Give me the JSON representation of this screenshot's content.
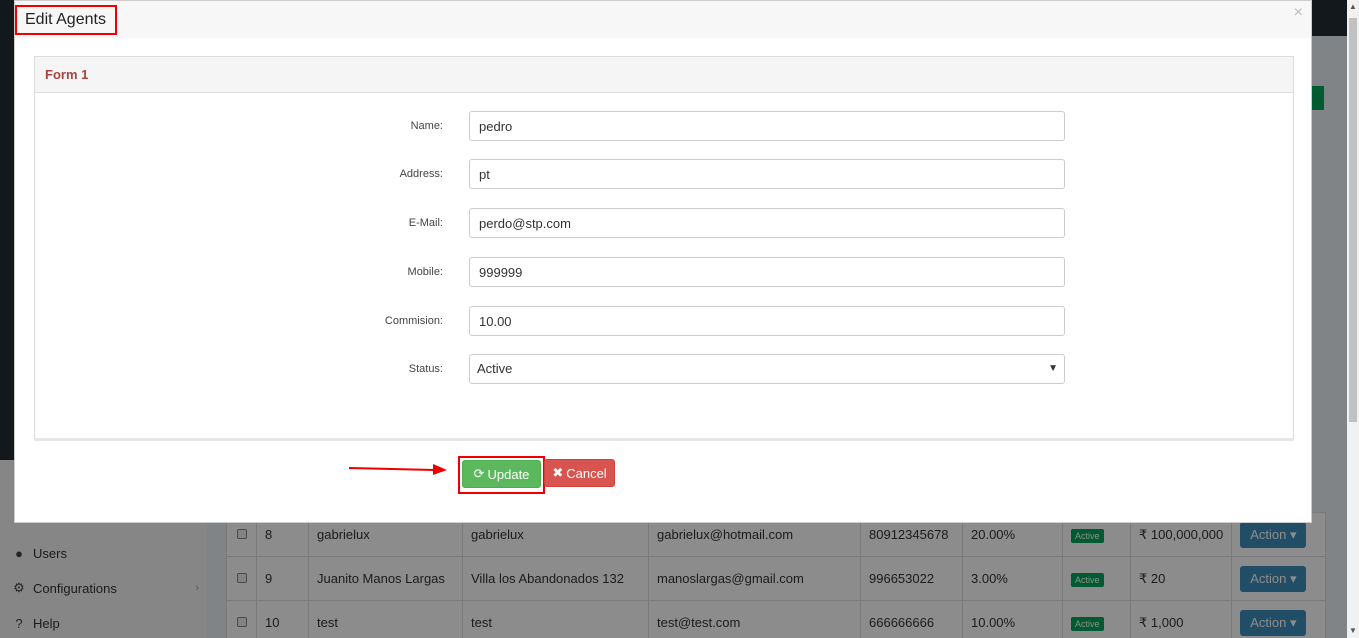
{
  "modal": {
    "title": "Edit Agents",
    "close_glyph": "×",
    "panel_title": "Form 1",
    "fields": {
      "name": {
        "label": "Name:",
        "value": "pedro"
      },
      "address": {
        "label": "Address:",
        "value": "pt"
      },
      "email": {
        "label": "E-Mail:",
        "value": "perdo@stp.com"
      },
      "mobile": {
        "label": "Mobile:",
        "value": "999999"
      },
      "commision": {
        "label": "Commision:",
        "value": "10.00"
      },
      "status": {
        "label": "Status:",
        "value": "Active"
      }
    },
    "update_label": "Update",
    "cancel_label": "Cancel"
  },
  "sidebar": {
    "items": [
      {
        "label": "Users",
        "icon": "user-icon"
      },
      {
        "label": "Configurations",
        "icon": "cogs-icon"
      },
      {
        "label": "Help",
        "icon": "help-icon"
      }
    ]
  },
  "table": {
    "rows": [
      {
        "id": "8",
        "name": "gabrielux",
        "address": "gabrielux",
        "email": "gabrielux@hotmail.com",
        "mobile": "80912345678",
        "commission": "20.00%",
        "status": "Active",
        "amount": "100,000,000",
        "action": "Action"
      },
      {
        "id": "9",
        "name": "Juanito Manos Largas",
        "address": "Villa los Abandonados 132",
        "email": "manoslargas@gmail.com",
        "mobile": "996653022",
        "commission": "3.00%",
        "status": "Active",
        "amount": "20",
        "action": "Action"
      },
      {
        "id": "10",
        "name": "test",
        "address": "test",
        "email": "test@test.com",
        "mobile": "666666666",
        "commission": "10.00%",
        "status": "Active",
        "amount": "1,000",
        "action": "Action"
      }
    ]
  },
  "currency_symbol": "₹",
  "colors": {
    "update": "#5cb85c",
    "cancel": "#d9534f",
    "highlight": "#e00000",
    "panel_title": "#a94442"
  }
}
